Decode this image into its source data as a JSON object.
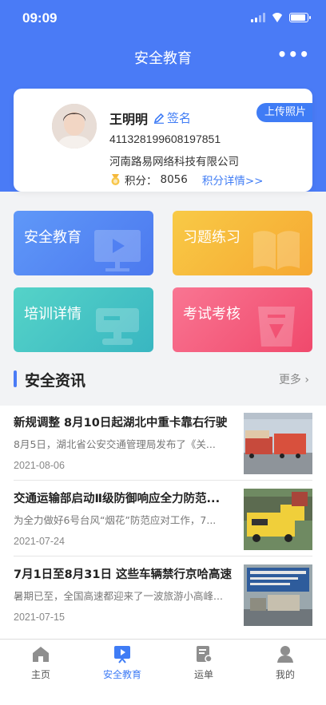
{
  "status": {
    "time": "09:09"
  },
  "header": {
    "title": "安全教育",
    "more": "•••"
  },
  "profile": {
    "name": "王明明",
    "sign_label": "签名",
    "id_number": "411328199608197851",
    "company": "河南路易网络科技有限公司",
    "points_label": "积分：",
    "points_value": "8056",
    "points_link": "积分详情>>",
    "upload_label": "上传照片"
  },
  "tiles": [
    {
      "label": "安全教育",
      "icon": "play-board-icon"
    },
    {
      "label": "习题练习",
      "icon": "open-book-icon"
    },
    {
      "label": "培训详情",
      "icon": "training-icon"
    },
    {
      "label": "考试考核",
      "icon": "exam-icon"
    }
  ],
  "section": {
    "title": "安全资讯",
    "more": "更多"
  },
  "news": [
    {
      "title": "新规调整 8月10日起湖北中重卡靠右行驶",
      "summary": "8月5日，湖北省公安交通管理局发布了《关...",
      "date": "2021-08-06"
    },
    {
      "title": "交通运输部启动Ⅱ级防御响应全力防范...",
      "summary": "为全力做好6号台风“烟花”防范应对工作，7...",
      "date": "2021-07-24"
    },
    {
      "title": "7月1日至8月31日 这些车辆禁行京哈高速",
      "summary": "暑期已至，全国高速都迎来了一波旅游小高峰...",
      "date": "2021-07-15"
    }
  ],
  "tabbar": [
    {
      "label": "主页",
      "icon": "home-icon",
      "active": false
    },
    {
      "label": "安全教育",
      "icon": "safety-education-icon",
      "active": true
    },
    {
      "label": "运单",
      "icon": "waybill-icon",
      "active": false
    },
    {
      "label": "我的",
      "icon": "user-icon",
      "active": false
    }
  ],
  "colors": {
    "primary": "#4a7bf6",
    "accent_link": "#3f7cf5",
    "tile_blue": "#5f98f8",
    "tile_orange": "#f8ca46",
    "tile_teal": "#55d3c8",
    "tile_pink": "#f97592"
  }
}
